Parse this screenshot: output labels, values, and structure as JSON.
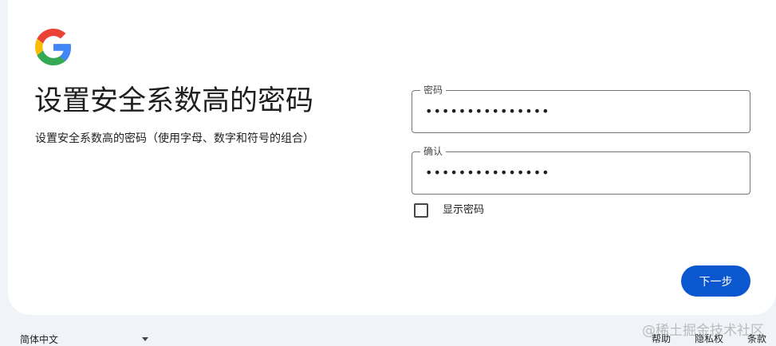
{
  "heading": {
    "title": "设置安全系数高的密码",
    "subtitle": "设置安全系数高的密码（使用字母、数字和符号的组合）"
  },
  "form": {
    "password": {
      "label": "密码",
      "value": "•••••••••••••••"
    },
    "confirm": {
      "label": "确认",
      "value": "•••••••••••••••"
    },
    "show_password_label": "显示密码",
    "next_label": "下一步"
  },
  "footer": {
    "language": "简体中文",
    "help": "帮助",
    "privacy": "隐私权",
    "terms": "条款"
  },
  "watermark": "@稀土掘金技术社区",
  "colors": {
    "primary": "#0b57d0",
    "background": "#f0f4f9"
  }
}
